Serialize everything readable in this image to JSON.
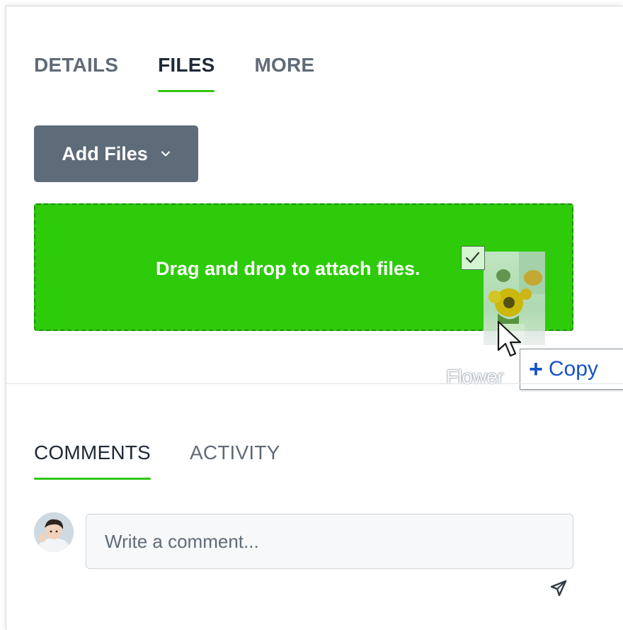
{
  "top_tabs": [
    {
      "label": "DETAILS",
      "active": false
    },
    {
      "label": "FILES",
      "active": true
    },
    {
      "label": "MORE",
      "active": false
    }
  ],
  "add_files": {
    "label": "Add Files",
    "icon": "chevron-down-icon"
  },
  "dropzone": {
    "message": "Drag and drop to attach files."
  },
  "drag_preview": {
    "filename": "Flower",
    "icon": "checkbox-checked-icon"
  },
  "copy_tooltip": {
    "symbol": "+",
    "label": "Copy"
  },
  "bottom_tabs": [
    {
      "label": "COMMENTS",
      "active": true
    },
    {
      "label": "ACTIVITY",
      "active": false
    }
  ],
  "comment": {
    "placeholder": "Write a comment...",
    "value": "",
    "send_icon": "send-icon"
  },
  "colors": {
    "accent": "#2ec60c",
    "dropzone_bg": "#2ecb0a",
    "button_bg": "#5e6b78",
    "copy_text": "#1653c4"
  }
}
